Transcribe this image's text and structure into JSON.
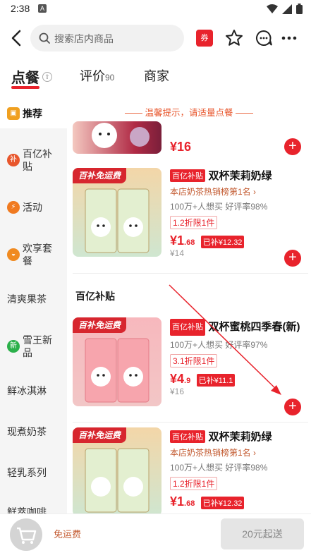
{
  "status": {
    "time": "2:38",
    "badge": "A"
  },
  "header": {
    "search_placeholder": "搜索店内商品",
    "coupon_label": "券"
  },
  "tabs": [
    {
      "label": "点餐",
      "count": ""
    },
    {
      "label": "评价",
      "count": "90"
    },
    {
      "label": "商家",
      "count": ""
    }
  ],
  "sidebar": {
    "items": [
      {
        "label": "推荐",
        "icon": "recommend-icon",
        "color": "#f0a020"
      },
      {
        "label": "百亿补贴",
        "icon": "subsidy-icon",
        "color": "#e8562c"
      },
      {
        "label": "活动",
        "icon": "lightning-icon",
        "color": "#f07a20"
      },
      {
        "label": "欢享套餐",
        "icon": "bowl-icon",
        "color": "#f08a20"
      },
      {
        "label": "清爽果茶",
        "icon": "",
        "color": ""
      },
      {
        "label": "雪王新品",
        "icon": "new-icon",
        "color": "#2bb04a"
      },
      {
        "label": "鲜冰淇淋",
        "icon": "",
        "color": ""
      },
      {
        "label": "现煮奶茶",
        "icon": "",
        "color": ""
      },
      {
        "label": "轻乳系列",
        "icon": "",
        "color": ""
      },
      {
        "label": "鲜萃咖啡",
        "icon": "",
        "color": ""
      }
    ]
  },
  "main": {
    "tip": "—— 温馨提示，请适量点餐 ——",
    "top_price": "¥16",
    "section_title": "百亿补贴",
    "products": [
      {
        "banner": "百补免运费",
        "tag": "百亿补贴",
        "name": "双杯茉莉奶绿",
        "rank": "本店奶茶热销榜第1名 ›",
        "meta": "100万+人想买 好评率98%",
        "discount": "1.2折限1件",
        "price_int": "¥1",
        "price_dec": ".68",
        "subsidy": "已补¥12.32",
        "original": "¥14"
      },
      {
        "banner": "百补免运费",
        "tag": "百亿补贴",
        "name": "双杯蜜桃四季春(新)",
        "rank": "",
        "meta": "100万+人想买 好评率97%",
        "discount": "3.1折限1件",
        "price_int": "¥4",
        "price_dec": ".9",
        "subsidy": "已补¥11.1",
        "original": "¥16"
      },
      {
        "banner": "百补免运费",
        "tag": "百亿补贴",
        "name": "双杯茉莉奶绿",
        "rank": "本店奶茶热销榜第1名 ›",
        "meta": "100万+人想买 好评率98%",
        "discount": "1.2折限1件",
        "price_int": "¥1",
        "price_dec": ".68",
        "subsidy": "已补¥12.32",
        "original": ""
      }
    ]
  },
  "bottom": {
    "free_shipping": "免运费",
    "min_order": "20元起送"
  },
  "colors": {
    "accent": "#e8232c",
    "tip": "#e8562c",
    "sidebar_bg": "#f5f5f5"
  }
}
